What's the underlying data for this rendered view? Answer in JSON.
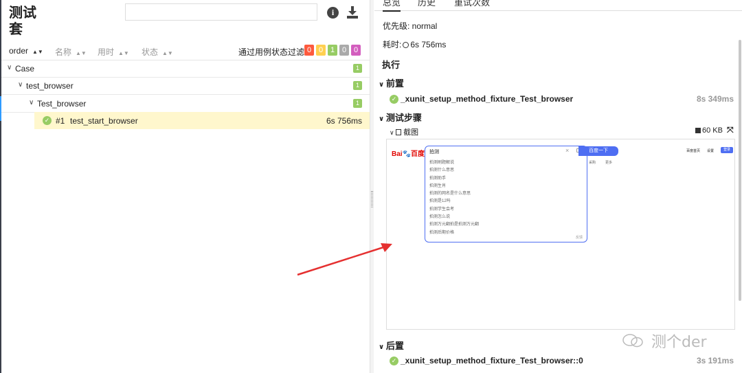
{
  "app": {
    "title": "测试套"
  },
  "colors": {
    "passed": "#97cc64",
    "failed": "#fd5a3e",
    "broken": "#ffd050",
    "skipped": "#aaaaaa",
    "unknown": "#d35ebe"
  },
  "sortbar": {
    "columns": [
      "order",
      "名称",
      "用时",
      "状态"
    ],
    "filter_label": "通过用例状态过滤:",
    "filter_counts": [
      "0",
      "0",
      "1",
      "0",
      "0"
    ]
  },
  "tree": {
    "case_label": "Case",
    "case_count": "1",
    "browser_label": "test_browser",
    "browser_count": "1",
    "class_label": "Test_browser",
    "class_count": "1",
    "test": {
      "number": "#1",
      "name": "test_start_browser",
      "duration": "6s 756ms"
    }
  },
  "detail": {
    "tabs": [
      "总览",
      "历史",
      "重试次数"
    ],
    "priority": "优先级: normal",
    "duration_label": "耗时:",
    "duration_value": "6s 756ms",
    "execution": "执行",
    "setup": "前置",
    "setup_fixture": "_xunit_setup_method_fixture_Test_browser",
    "setup_duration": "8s 349ms",
    "steps": "测试步骤",
    "screenshot_label": "截图",
    "screenshot_size": "60 KB",
    "teardown": "后置",
    "teardown_fixture": "_xunit_setup_method_fixture_Test_browser::0",
    "teardown_duration": "3s 191ms"
  },
  "screenshot": {
    "logo_a": "Bai",
    "logo_b": "百度",
    "query": "拍测",
    "clear": "×",
    "button": "百度一下",
    "suggestions": [
      "拍测刷题解说",
      "拍测什么意思",
      "拍测助手",
      "拍测生肖",
      "拍测的网名是什么意思",
      "拍测是12吗",
      "拍测学生会考",
      "拍测怎么说",
      "拍测万元翻拍是拍测万元翻",
      "拍测后期价格"
    ],
    "feedback": "反馈",
    "more_links": [
      "采购",
      "更多"
    ],
    "nav": [
      "百度首页",
      "设置"
    ],
    "login": "登录"
  },
  "watermark": "测个der"
}
